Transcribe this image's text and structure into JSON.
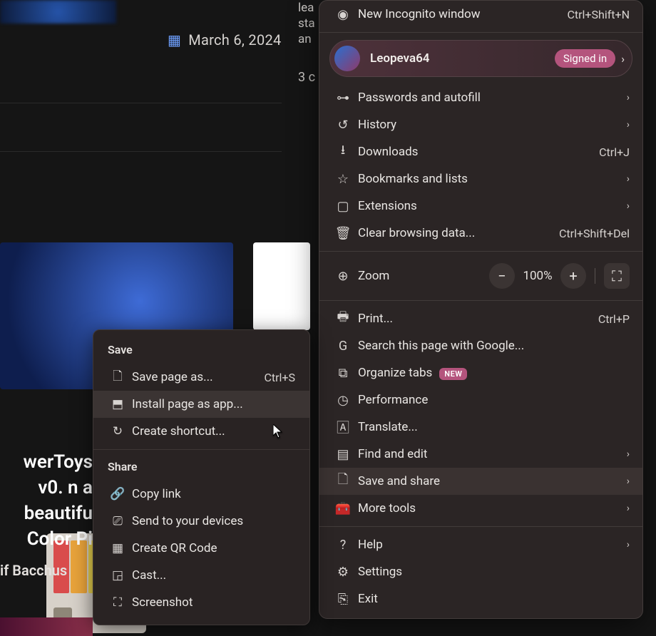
{
  "page": {
    "date": "March 6, 2024",
    "text_snip": "lea\nsta\nan",
    "comment_snip": "3 c",
    "headline": "werToys v0.\nn a beautifu\nColor Pi",
    "author": "if Bacchus"
  },
  "chrome_menu": {
    "new_incognito": {
      "label": "New Incognito window",
      "shortcut": "Ctrl+Shift+N"
    },
    "profile": {
      "name": "Leopeva64",
      "badge": "Signed in"
    },
    "items": [
      {
        "icon": "key-icon",
        "label": "Passwords and autofill",
        "chev": true
      },
      {
        "icon": "history-icon",
        "label": "History",
        "chev": true
      },
      {
        "icon": "download-icon",
        "label": "Downloads",
        "shortcut": "Ctrl+J"
      },
      {
        "icon": "star-icon",
        "label": "Bookmarks and lists",
        "chev": true
      },
      {
        "icon": "puzzle-icon",
        "label": "Extensions",
        "chev": true
      },
      {
        "icon": "trash-icon",
        "label": "Clear browsing data...",
        "shortcut": "Ctrl+Shift+Del"
      }
    ],
    "zoom": {
      "label": "Zoom",
      "minus": "−",
      "pct": "100%",
      "plus": "+"
    },
    "group2": [
      {
        "icon": "print-icon",
        "label": "Print...",
        "shortcut": "Ctrl+P"
      },
      {
        "icon": "google-icon",
        "label": "Search this page with Google..."
      },
      {
        "icon": "tabs-icon",
        "label": "Organize tabs",
        "new": "NEW"
      },
      {
        "icon": "speedo-icon",
        "label": "Performance"
      },
      {
        "icon": "translate-icon",
        "label": "Translate..."
      },
      {
        "icon": "find-icon",
        "label": "Find and edit",
        "chev": true
      },
      {
        "icon": "save-icon",
        "label": "Save and share",
        "chev": true,
        "hl": true
      },
      {
        "icon": "tools-icon",
        "label": "More tools",
        "chev": true
      }
    ],
    "group3": [
      {
        "icon": "help-icon",
        "label": "Help",
        "chev": true
      },
      {
        "icon": "gear-icon",
        "label": "Settings"
      },
      {
        "icon": "exit-icon",
        "label": "Exit"
      }
    ]
  },
  "submenu": {
    "save_heading": "Save",
    "save_items": [
      {
        "icon": "page-icon",
        "label": "Save page as...",
        "shortcut": "Ctrl+S"
      },
      {
        "icon": "install-icon",
        "label": "Install page as app...",
        "hl": true
      },
      {
        "icon": "shortcut-icon",
        "label": "Create shortcut..."
      }
    ],
    "share_heading": "Share",
    "share_items": [
      {
        "icon": "link-icon",
        "label": "Copy link"
      },
      {
        "icon": "devices-icon",
        "label": "Send to your devices"
      },
      {
        "icon": "qr-icon",
        "label": "Create QR Code"
      },
      {
        "icon": "cast-icon",
        "label": "Cast..."
      },
      {
        "icon": "screenshot-icon",
        "label": "Screenshot"
      }
    ]
  },
  "glyph": {
    "calendar-icon": "▦",
    "key-icon": "⊶",
    "history-icon": "↺",
    "download-icon": "⭳",
    "star-icon": "☆",
    "puzzle-icon": "▢",
    "trash-icon": "🗑",
    "zoom-icon": "⊕",
    "fullscreen-icon": "⛶",
    "print-icon": "🖶",
    "google-icon": "G",
    "tabs-icon": "⧉",
    "speedo-icon": "◷",
    "translate-icon": "🄰",
    "find-icon": "▤",
    "save-icon": "🗋",
    "tools-icon": "🧰",
    "help-icon": "?",
    "gear-icon": "⚙",
    "exit-icon": "⎘",
    "incognito-icon": "◉",
    "page-icon": "🗋",
    "install-icon": "⬒",
    "shortcut-icon": "↻",
    "link-icon": "🔗",
    "devices-icon": "⎚",
    "qr-icon": "▦",
    "cast-icon": "◲",
    "screenshot-icon": "⛶",
    "chevron-right-icon": "›"
  }
}
